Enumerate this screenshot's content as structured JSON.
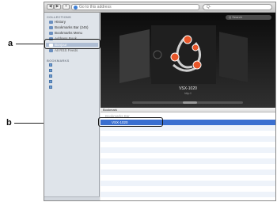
{
  "callouts": {
    "a": "a",
    "b": "b"
  },
  "toolbar": {
    "back": "◀",
    "forward": "▶",
    "add": "+",
    "address_placeholder": "Go to this address",
    "search_placeholder": "Q-"
  },
  "sidebar": {
    "collections_header": "COLLECTIONS",
    "collections": [
      "History",
      "Bookmarks Bar (245)",
      "Bookmarks Menu",
      "Address Book",
      "Bonjour",
      "All RSS Feeds"
    ],
    "bookmarks_header": "BOOKMARKS"
  },
  "coverflow": {
    "search": "Q Search",
    "caption": "VSX-1020",
    "subtitle": "http://"
  },
  "list": {
    "header": "Bookmark",
    "parent_label": "Bookmarks Bar",
    "selected_item": "VSX-1020"
  },
  "colors": {
    "selection": "#3a6fd0",
    "logo_orange": "#e8572a"
  }
}
